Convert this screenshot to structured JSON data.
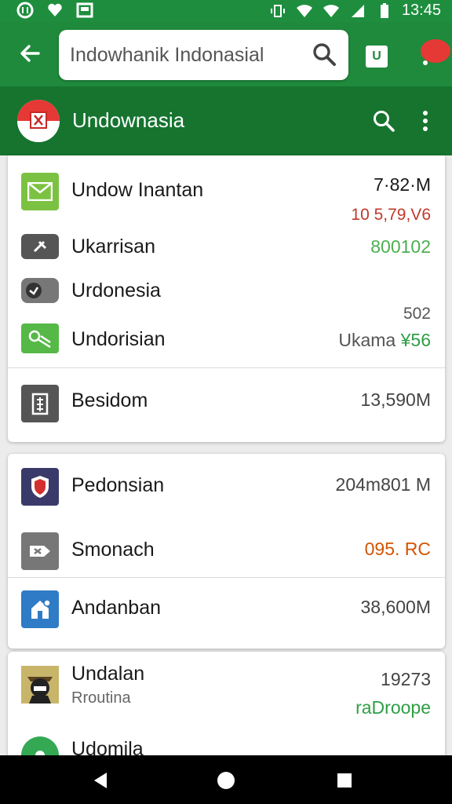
{
  "status_bar": {
    "time": "13:45",
    "left_icons": [
      "messenger-icon",
      "heart-icon",
      "gallery-icon"
    ],
    "right_icons": [
      "vibrate-icon",
      "wifi-icon",
      "signal-icon",
      "signal-2-icon",
      "battery-icon"
    ]
  },
  "search": {
    "value": "Indowhanik Indonasial",
    "badge": "U"
  },
  "app_bar": {
    "title": "Undownasia"
  },
  "card1": {
    "rows": [
      {
        "label": "Undow Inantan",
        "value": "7·82·M",
        "value2": "10 5,79,V6",
        "value2_color": "#c0392b"
      },
      {
        "label": "Ukarrisan",
        "value": "800102",
        "value_color": "#4caf50"
      },
      {
        "label": "Urdonesia"
      },
      {
        "label": "Undorisian",
        "value_top": "502",
        "value_a": "Ukama",
        "value_b": "¥56",
        "value_b_color": "#2e9e46"
      },
      {
        "label": "Besidom",
        "value": "13,590M"
      }
    ]
  },
  "card2": {
    "rows": [
      {
        "label": "Pedonsian",
        "value": "204m801 M"
      },
      {
        "label": "Smonach",
        "value": "095. RC",
        "value_color": "#d35400"
      },
      {
        "label": "Andanban",
        "value": "38,600M"
      }
    ]
  },
  "card3": {
    "rows": [
      {
        "label": "Undalan",
        "sub": "Rroutina",
        "value_top": "19273",
        "value": "raDroope",
        "value_color": "#2e9e46"
      },
      {
        "label": "Udomila"
      }
    ]
  },
  "colors": {
    "status_green": "#1e8e3e",
    "search_green": "#1f8a3c",
    "appbar_green": "#16742f"
  }
}
